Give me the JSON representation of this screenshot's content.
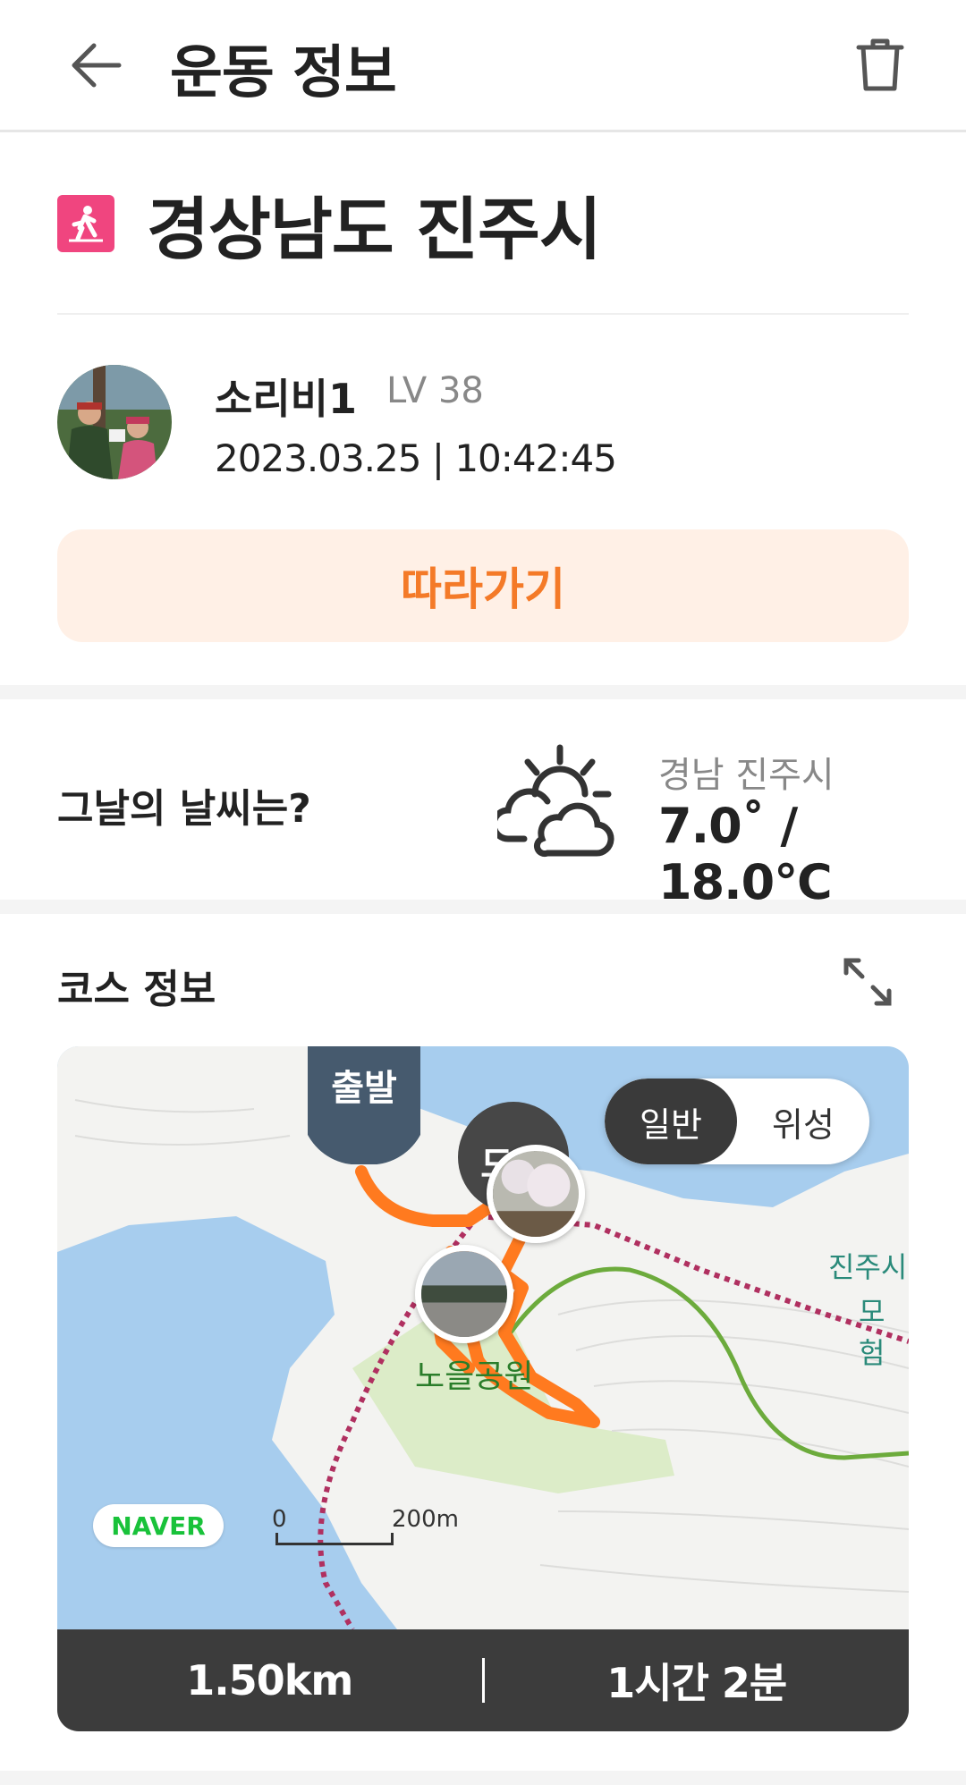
{
  "header": {
    "title": "운동 정보"
  },
  "place": {
    "title": "경상남도 진주시"
  },
  "user": {
    "name": "소리비1",
    "level": "LV 38",
    "datetime": "2023.03.25 | 10:42:45"
  },
  "follow_button": {
    "label": "따라가기"
  },
  "weather": {
    "question": "그날의 날씨는?",
    "location": "경남 진주시",
    "temperature": "7.0˚ / 18.0℃"
  },
  "course": {
    "title": "코스 정보",
    "map": {
      "start_label": "출발",
      "end_label": "도착",
      "park_label": "노을공원",
      "poi_label_line1": "진주시",
      "poi_label_line2": "모험",
      "toggle": {
        "normal": "일반",
        "satellite": "위성",
        "selected": "일반"
      },
      "provider": "NAVER",
      "scale": {
        "zero": "0",
        "max": "200m"
      }
    },
    "stats": {
      "distance": "1.50km",
      "duration": "1시간 2분"
    }
  },
  "colors": {
    "accent": "#f47a28",
    "accent_bg": "#fff0e6",
    "route": "#ff7a1f",
    "walk_badge": "#f0457f"
  }
}
